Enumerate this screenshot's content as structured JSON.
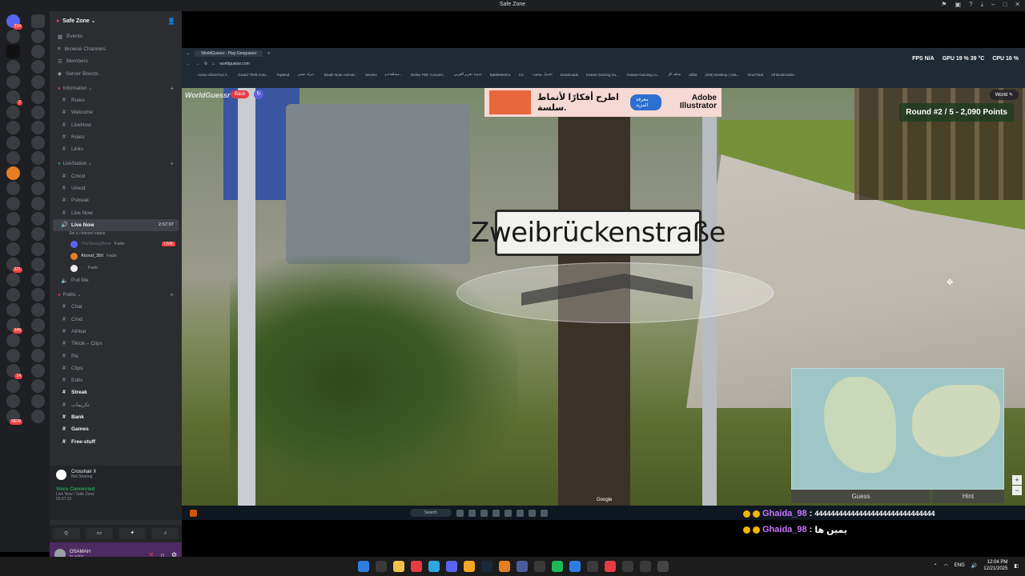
{
  "window": {
    "title": "Safe Zone"
  },
  "guild": {
    "name": "Safe Zone ⌄"
  },
  "nav": [
    "Events",
    "Browse Channels",
    "Members",
    "Server Boosts"
  ],
  "categories": {
    "information": "Information ⌄",
    "livestation": "LiveStation ⌄",
    "public": "Public ⌄"
  },
  "info_channels": [
    "Rules",
    "Welcome",
    "LiveNow",
    "Roles",
    "Links"
  ],
  "live_channels": [
    "Cmod",
    "Umod",
    "Pstreak",
    "Live Now"
  ],
  "active_voice": {
    "name": "Live Now",
    "time": "2:57:07",
    "status": "Set a channel status"
  },
  "voice_users": [
    {
      "name": "TheSleepyBear",
      "tag": "Fade",
      "live": "LIVE"
    },
    {
      "name": "Abood_350",
      "tag": "Fade",
      "live": ""
    },
    {
      "name": "...",
      "tag": "Fade",
      "live": ""
    }
  ],
  "pull_me": "Pull Me",
  "public_channels": [
    "Chat",
    "Cmd",
    "Athkar",
    "Tiktok – Clips",
    "Pic",
    "Clips",
    "Edits"
  ],
  "extra_channels": [
    "Streak",
    "تكريمات",
    "Bank",
    "Games",
    "Free-stuff"
  ],
  "activity": {
    "title": "Crosshair X",
    "subtitle": "Not Sharing"
  },
  "voice": {
    "status": "Voice Connected",
    "channel": "Live Now / Safe Zone",
    "time": "02:57:22"
  },
  "user": {
    "name": "OSAMAH",
    "status": "In voice"
  },
  "browser": {
    "tab": "WorldGuessr - Play Geoguessr",
    "url": "worldguessr.com",
    "bookmarks": [
      "Anna AdvanTool A...",
      "Grand Theft Auto...",
      "TopMod",
      "مزاد تنسي...",
      "Death Note Animat...",
      "Movies",
      "مشاهدة و...",
      "Online PDF Convert...",
      "مدونة تعزيز العربي",
      "BattleMetrics",
      "CC",
      "تحميل يوتيوب",
      "Downloads",
      "Instant Gaming Su...",
      "Instant-Gaming.co...",
      "شاهد كل",
      "alllist",
      "(409) Desktop | Gta...",
      "VirusTotal",
      "All Bookmarks"
    ]
  },
  "perf": {
    "fps_label": "FPS",
    "fps": "N/A",
    "gpu": "GPU 19 %  39 °C",
    "cpu": "CPU 16 %"
  },
  "game": {
    "logo": "WorldGuessr",
    "back": "Back",
    "world": "World",
    "round": "Round #2 / 5 - 2,090 Points",
    "sign": "Zweibrückenstraße",
    "guess": "Guess",
    "hint": "Hint",
    "attribution": "Google"
  },
  "ad": {
    "arabic": "اطرح أفكارًا\nلأنماط سلسة.",
    "button": "معرفة المزيد",
    "brand": "Adobe\nIllustrator"
  },
  "chat": [
    {
      "user": "Ghaida_98",
      "sep": ":",
      "msg": "444444444444444444444444444444"
    },
    {
      "user": "Ghaida_98",
      "sep": ":",
      "msg": "يمين ها"
    }
  ],
  "taskbar": {
    "search": "Search",
    "lang": "ENG",
    "time": "12:04 PM",
    "date": "12/21/2025"
  },
  "colors": {
    "discord_bg": "#2b2d31",
    "accent_live": "#f23f43",
    "voice_green": "#23a55a",
    "chat_user": "#c978ff"
  }
}
